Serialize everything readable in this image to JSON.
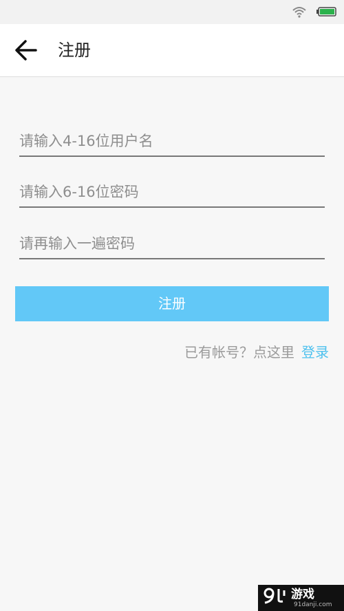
{
  "status_bar": {
    "icons": [
      "wifi-icon",
      "battery-icon"
    ],
    "battery_color": "#2bb24c"
  },
  "header": {
    "back_icon": "arrow-left-icon",
    "title": "注册"
  },
  "form": {
    "username_placeholder": "请输入4-16位用户名",
    "password_placeholder": "请输入6-16位密码",
    "confirm_placeholder": "请再输入一遍密码",
    "register_label": "注册",
    "login_hint": "已有帐号？点这里",
    "login_link": "登录"
  },
  "watermark": {
    "logo_text": "游戏",
    "url": "91danji.com"
  },
  "colors": {
    "button": "#62c8f7",
    "link": "#4ec1ee",
    "background": "#f7f7f7"
  }
}
